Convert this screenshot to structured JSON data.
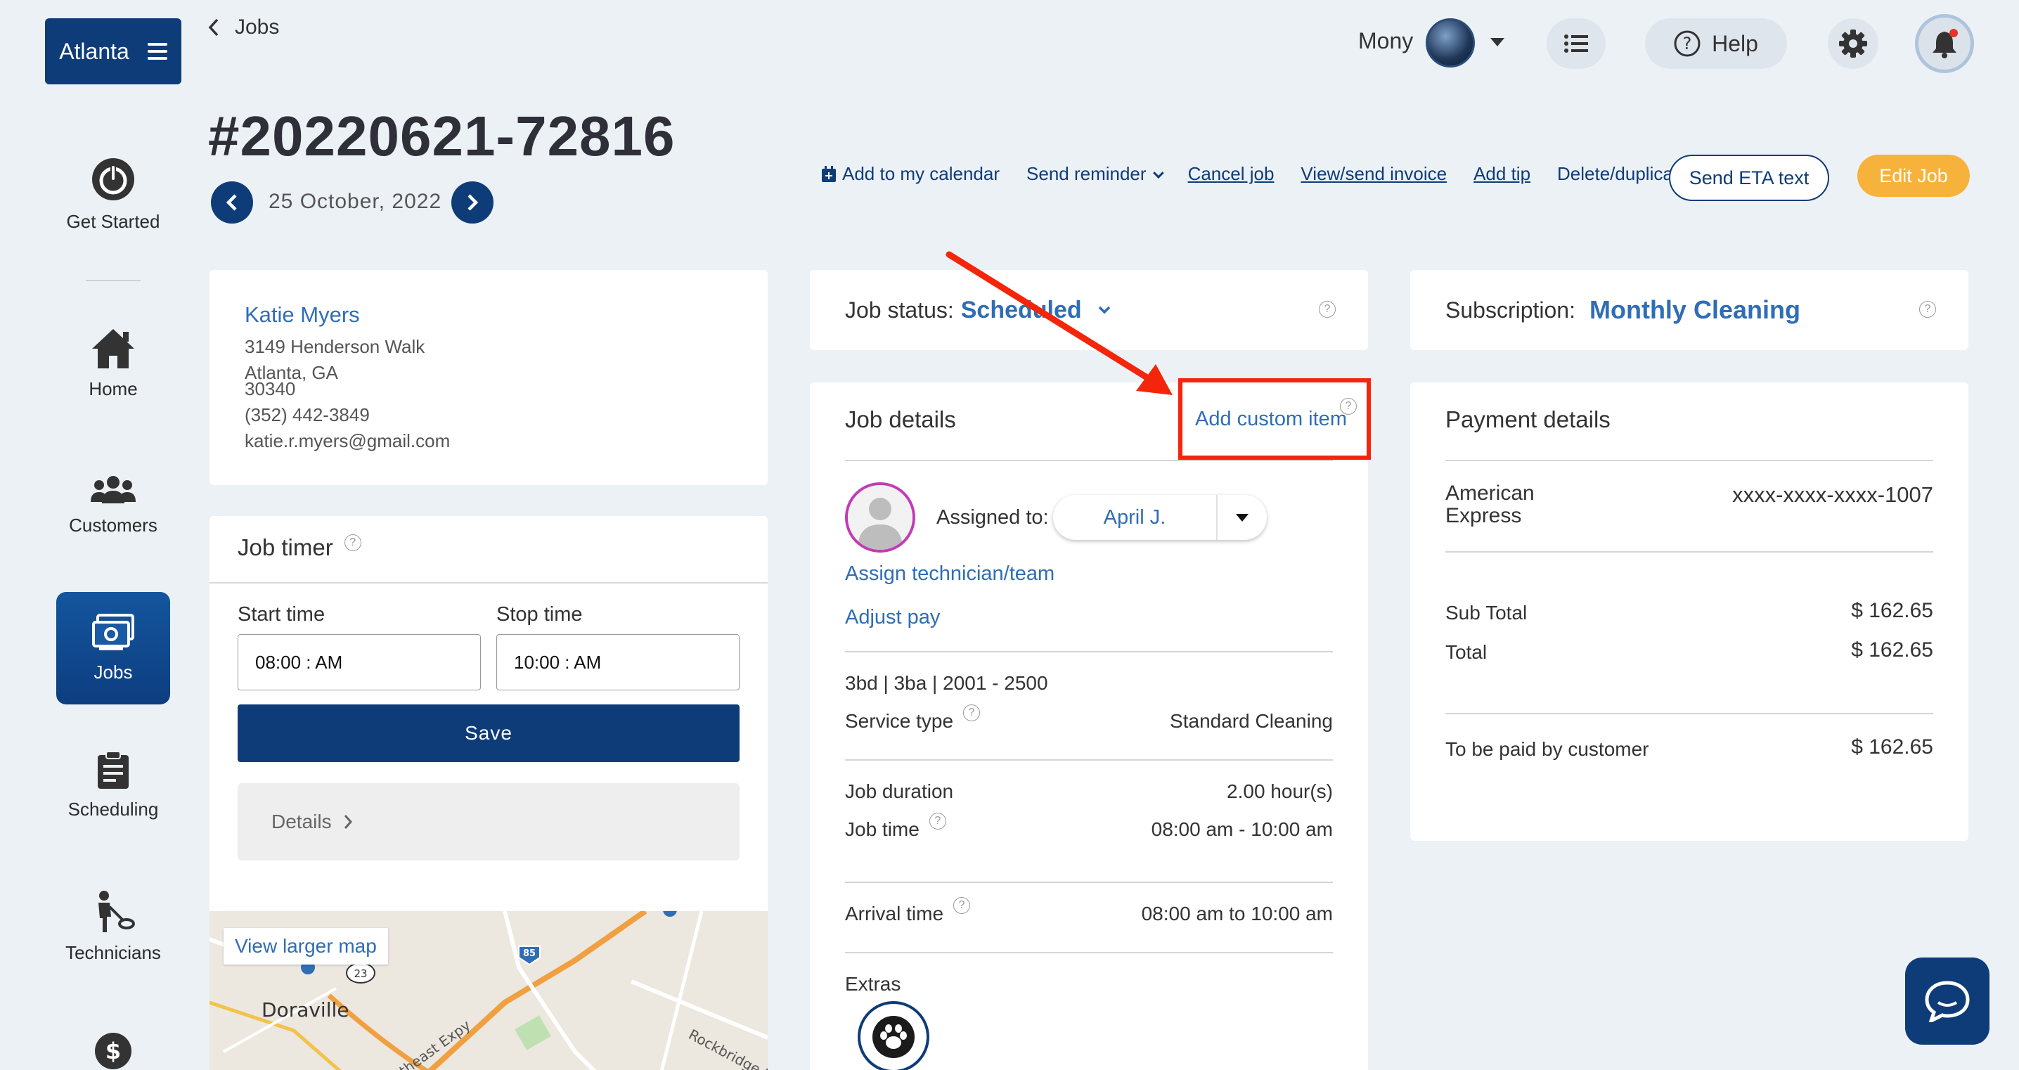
{
  "brand": {
    "label": "Atlanta"
  },
  "sidebar": {
    "items": [
      {
        "label": "Get Started"
      },
      {
        "label": "Home"
      },
      {
        "label": "Customers"
      },
      {
        "label": "Jobs"
      },
      {
        "label": "Scheduling"
      },
      {
        "label": "Technicians"
      }
    ]
  },
  "header": {
    "breadcrumb": "Jobs",
    "job_number": "#20220621-72816",
    "date": "25 October, 2022",
    "user_name": "Mony",
    "help_label": "Help"
  },
  "actions": {
    "calendar": "Add to my calendar",
    "reminder": "Send reminder",
    "cancel": "Cancel job",
    "invoice": "View/send invoice",
    "tip": "Add tip",
    "delete": "Delete/duplicate",
    "eta": "Send ETA text",
    "edit": "Edit Job"
  },
  "customer": {
    "name": "Katie Myers",
    "street": "3149 Henderson Walk",
    "city": "Atlanta, GA",
    "zip": "30340",
    "phone": "(352) 442-3849",
    "email": "katie.r.myers@gmail.com"
  },
  "timer": {
    "title": "Job timer",
    "start_label": "Start time",
    "stop_label": "Stop time",
    "start_value": "08:00 : AM",
    "stop_value": "10:00 : AM",
    "save_label": "Save",
    "details_label": "Details",
    "map_link": "View larger map",
    "map_places": {
      "doraville": "Doraville",
      "expressway": "rtheast Expy",
      "rockbridge": "Rockbridge R",
      "interstate": "85",
      "route": "23"
    }
  },
  "job_status": {
    "label": "Job status:",
    "value": "Scheduled"
  },
  "job_details": {
    "title": "Job details",
    "add_custom_item": "Add custom item",
    "assigned_label": "Assigned to:",
    "assigned_value": "April J.",
    "assign_link": "Assign technician/team",
    "adjust_pay": "Adjust pay",
    "home_size": "3bd | 3ba | 2001 - 2500",
    "service_type_label": "Service type",
    "service_type_value": "Standard Cleaning",
    "duration_label": "Job duration",
    "duration_value": "2.00 hour(s)",
    "job_time_label": "Job time",
    "job_time_value": "08:00 am - 10:00 am",
    "arrival_label": "Arrival time",
    "arrival_value": "08:00 am to 10:00 am",
    "extras_label": "Extras"
  },
  "subscription": {
    "label": "Subscription:",
    "value": "Monthly Cleaning"
  },
  "payment": {
    "title": "Payment details",
    "card_brand_line1": "American",
    "card_brand_line2": "Express",
    "card_number": "xxxx-xxxx-xxxx-1007",
    "subtotal_label": "Sub Total",
    "subtotal_value": "$ 162.65",
    "total_label": "Total",
    "total_value": "$ 162.65",
    "to_be_paid_label": "To be paid by customer",
    "to_be_paid_value": "$ 162.65"
  },
  "colors": {
    "navy": "#0e3c78",
    "link_blue": "#2f6db5",
    "accent_orange": "#f7b23b",
    "annotation_red": "#f4250a",
    "background": "#ecf1f6"
  },
  "icons": [
    "hamburger-icon",
    "power-icon",
    "home-icon",
    "customers-icon",
    "jobs-icon",
    "clipboard-icon",
    "technician-icon",
    "dollar-icon",
    "chevron-left-icon",
    "chevron-right-icon",
    "list-icon",
    "help-icon",
    "gear-icon",
    "bell-icon",
    "calendar-icon",
    "paw-icon",
    "chat-icon"
  ]
}
